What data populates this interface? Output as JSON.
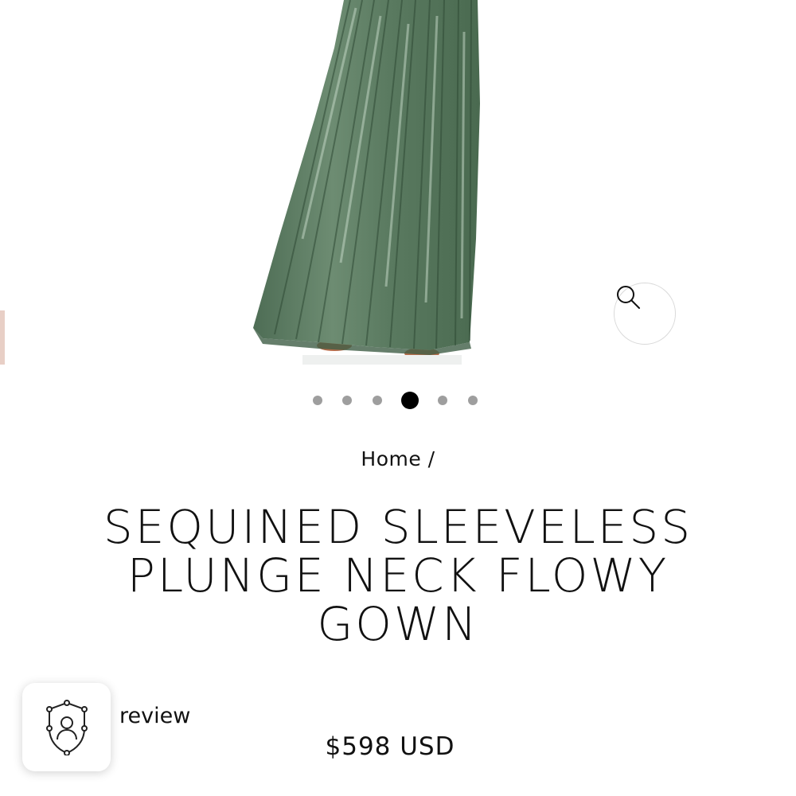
{
  "product_image": {
    "alt": "Green sequined flowy gown skirt",
    "zoom_icon": "magnifier-icon"
  },
  "carousel": {
    "dot_count": 6,
    "active_index": 3
  },
  "breadcrumb": {
    "home_label": "Home",
    "separator": "/"
  },
  "product": {
    "title": "SEQUINED SLEEVELESS PLUNGE NECK FLOWY GOWN",
    "price": "$598 USD"
  },
  "review_widget": {
    "icon": "shield-user-icon",
    "label": "review"
  },
  "colors": {
    "gown_green": "#5f7f64",
    "dot_inactive": "#9e9e9e",
    "dot_active": "#000000"
  }
}
